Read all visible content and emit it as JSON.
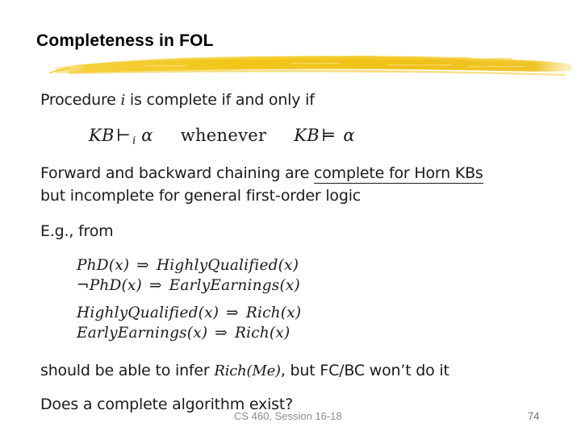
{
  "slide": {
    "title": "Completeness in FOL",
    "accent_color": "#F2C518",
    "text_color": "#1a1a1a",
    "background_color": "#ffffff"
  },
  "body": {
    "procedure_line": {
      "before": "Procedure",
      "italic": "i",
      "after": "is complete if and only if"
    },
    "equation_iff": {
      "lhs_kb": "KB",
      "turnstile": "⊢",
      "turnstile_sub": "i",
      "lhs_alpha": "α",
      "connector": "whenever",
      "rhs_kb": "KB",
      "models": "⊨",
      "rhs_alpha": "α",
      "plain": "KB ⊢i α   whenever   KB ⊨ α"
    },
    "chaining_line_1_prefix": "Forward and backward chaining are ",
    "chaining_line_1_underlined": "complete for Horn KBs",
    "chaining_line_2": "but incomplete for general first-order logic",
    "eg_line": "E.g., from",
    "rules": [
      {
        "antecedent": "PhD(x)",
        "arrow": "⇒",
        "consequent": "HighlyQualified(x)",
        "negated": false
      },
      {
        "antecedent": "PhD(x)",
        "arrow": "⇒",
        "consequent": "EarlyEarnings(x)",
        "negated": true,
        "negation_symbol": "¬"
      },
      {
        "antecedent": "HighlyQualified(x)",
        "arrow": "⇒",
        "consequent": "Rich(x)",
        "negated": false
      },
      {
        "antecedent": "EarlyEarnings(x)",
        "arrow": "⇒",
        "consequent": "Rich(x)",
        "negated": false
      }
    ],
    "infer_line": {
      "before": "should be able to infer ",
      "math": "Rich(Me)",
      "after": ", but FC/BC won’t do it"
    },
    "question_line": "Does a complete algorithm exist?"
  },
  "footer": {
    "center_text": "CS 460, Session 16-18",
    "page_number": "74"
  }
}
